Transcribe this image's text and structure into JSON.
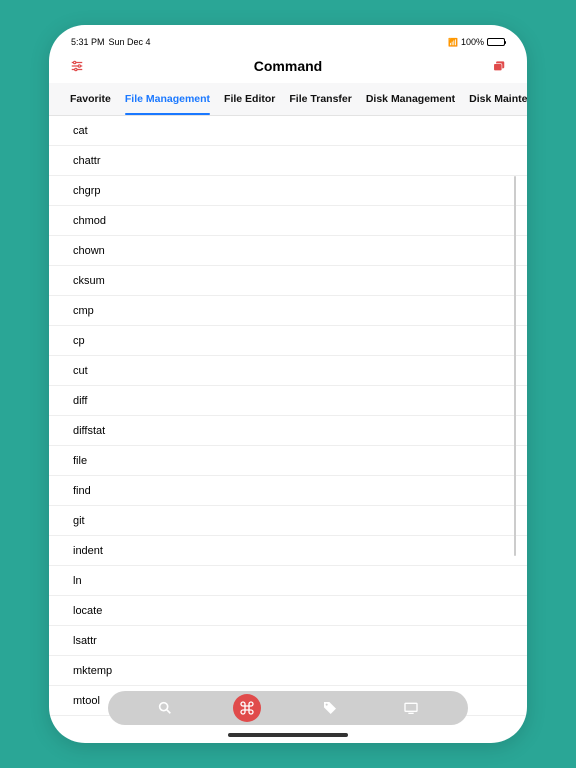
{
  "status": {
    "time": "5:31 PM",
    "date": "Sun Dec 4",
    "battery_pct": "100%"
  },
  "nav": {
    "title": "Command"
  },
  "tabs": [
    {
      "label": "Favorite",
      "active": false
    },
    {
      "label": "File Management",
      "active": true
    },
    {
      "label": "File Editor",
      "active": false
    },
    {
      "label": "File Transfer",
      "active": false
    },
    {
      "label": "Disk Management",
      "active": false
    },
    {
      "label": "Disk Maintenance",
      "active": false
    }
  ],
  "commands": [
    "cat",
    "chattr",
    "chgrp",
    "chmod",
    "chown",
    "cksum",
    "cmp",
    "cp",
    "cut",
    "diff",
    "diffstat",
    "file",
    "find",
    "git",
    "indent",
    "ln",
    "locate",
    "lsattr",
    "mktemp",
    "mtool"
  ],
  "colors": {
    "background": "#2aa696",
    "accent_blue": "#1a78ff",
    "accent_red": "#e04b4b"
  }
}
